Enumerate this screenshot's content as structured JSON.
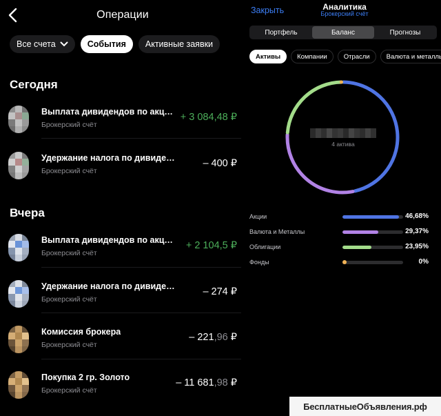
{
  "operations": {
    "title": "Операции",
    "filters": [
      {
        "label": "Все счета",
        "active": false,
        "dropdown": true
      },
      {
        "label": "События",
        "active": true,
        "dropdown": false
      },
      {
        "label": "Активные заявки",
        "active": false,
        "dropdown": false
      }
    ],
    "groups": [
      {
        "title": "Сегодня",
        "items": [
          {
            "name": "Выплата дивидендов по акция...",
            "account": "Брокерский счёт",
            "sign": "+ ",
            "int": "3 084",
            "frac": ",48",
            "cur": " ₽",
            "positive": true,
            "icon_colors": [
              "#8d8d8d",
              "#b9b9b9",
              "#707070",
              "#c3c3c3",
              "#a88f8f",
              "#8aa893",
              "#7a7a7a",
              "#c0c0c0",
              "#9a9a9a",
              "#6d6d6d",
              "#b0b0b0",
              "#8c8c8c"
            ]
          },
          {
            "name": "Удержание налога по дивидендам",
            "account": "Брокерский счёт",
            "sign": "– ",
            "int": "400",
            "frac": "",
            "cur": " ₽",
            "positive": false,
            "icon_colors": [
              "#9a9a9a",
              "#c8c8c8",
              "#7c7c7c",
              "#d0d0d0",
              "#b68a8a",
              "#94b09a",
              "#818181",
              "#cfcfcf",
              "#a3a3a3",
              "#777777",
              "#bdbdbd",
              "#999999"
            ]
          }
        ]
      },
      {
        "title": "Вчера",
        "items": [
          {
            "name": "Выплата дивидендов по акциям...",
            "account": "Брокерский счёт",
            "sign": "+ ",
            "int": "2 104",
            "frac": ",5",
            "cur": " ₽",
            "positive": true,
            "icon_colors": [
              "#9aa4b5",
              "#d8dce4",
              "#7b8799",
              "#e2e6ee",
              "#6a93d8",
              "#a4bce8",
              "#8494ad",
              "#dde2ea",
              "#a3aec0",
              "#76839a",
              "#c7cfdc",
              "#97a2b4"
            ]
          },
          {
            "name": "Удержание налога по дивидендам",
            "account": "Брокерский счёт",
            "sign": "– ",
            "int": "274",
            "frac": "",
            "cur": " ₽",
            "positive": false,
            "icon_colors": [
              "#a1abbb",
              "#dde1e8",
              "#7e899a",
              "#e5e8ee",
              "#6f97d9",
              "#a9c0ea",
              "#8a98af",
              "#e0e4eb",
              "#a8b2c3",
              "#7a869b",
              "#ccd3de",
              "#9ca6b7"
            ]
          },
          {
            "name": "Комиссия брокера",
            "account": "Брокерский счёт",
            "sign": "– ",
            "int": "221",
            "frac": ",96",
            "cur": " ₽",
            "positive": false,
            "icon_colors": [
              "#7a6142",
              "#c29a63",
              "#5e4a33",
              "#d4ad75",
              "#b08850",
              "#e1c08c",
              "#6b543a",
              "#caa26a",
              "#8d7150",
              "#54422d",
              "#bb9460",
              "#7f6546"
            ]
          },
          {
            "name": "Покупка 2 гр. Золото",
            "account": "Брокерский счёт",
            "sign": "– ",
            "int": "11 681",
            "frac": ",98",
            "cur": " ₽",
            "positive": false,
            "icon_colors": [
              "#7d6344",
              "#c49c65",
              "#614c35",
              "#d6af77",
              "#b28a52",
              "#e3c28e",
              "#6e563c",
              "#cca46c",
              "#907352",
              "#57442f",
              "#bd9662",
              "#826748"
            ]
          }
        ]
      }
    ]
  },
  "analytics": {
    "close_label": "Закрыть",
    "title": "Аналитика",
    "subtitle": "Брокерский счёт",
    "tabs": [
      {
        "label": "Портфель",
        "active": false
      },
      {
        "label": "Баланс",
        "active": true
      },
      {
        "label": "Прогнозы",
        "active": false
      }
    ],
    "subtabs": [
      {
        "label": "Активы",
        "active": true
      },
      {
        "label": "Компании",
        "active": false
      },
      {
        "label": "Отрасли",
        "active": false
      },
      {
        "label": "Валюта и металлы",
        "active": false
      }
    ],
    "center_caption": "4 актива",
    "colors": {
      "accent": "#3c7ef5",
      "positive": "#4cae5a"
    }
  },
  "chart_data": {
    "type": "pie",
    "categories": [
      "Акции",
      "Валюта и Металлы",
      "Облигации",
      "Фонды"
    ],
    "values": [
      46.68,
      29.37,
      23.95,
      0
    ],
    "labels": [
      "46,68%",
      "29,37%",
      "23,95%",
      "0%"
    ],
    "colors": [
      "#4f74e3",
      "#b182e5",
      "#a3dc8a",
      "#f0b256"
    ]
  },
  "watermark": "БесплатныеОбъявления.рф"
}
